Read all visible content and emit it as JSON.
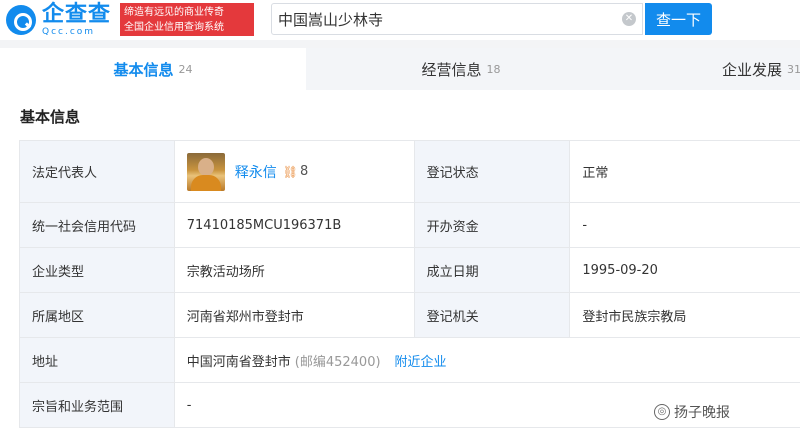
{
  "header": {
    "logo_name": "企查查",
    "logo_domain": "Qcc.com",
    "slogan_line1": "缔造有远见的商业传奇",
    "slogan_line2": "全国企业信用查询系统",
    "search_value": "中国嵩山少林寺",
    "search_button": "查一下"
  },
  "tabs": [
    {
      "label": "基本信息",
      "count": "24"
    },
    {
      "label": "经营信息",
      "count": "18"
    },
    {
      "label": "企业发展",
      "count": "31"
    }
  ],
  "section_title": "基本信息",
  "info": {
    "legal_rep_label": "法定代表人",
    "legal_rep_name": "释永信",
    "legal_rep_related": "8",
    "status_label": "登记状态",
    "status_value": "正常",
    "credit_code_label": "统一社会信用代码",
    "credit_code_value": "71410185MCU196371B",
    "capital_label": "开办资金",
    "capital_value": "-",
    "type_label": "企业类型",
    "type_value": "宗教活动场所",
    "established_label": "成立日期",
    "established_value": "1995-09-20",
    "region_label": "所属地区",
    "region_value": "河南省郑州市登封市",
    "authority_label": "登记机关",
    "authority_value": "登封市民族宗教局",
    "address_label": "地址",
    "address_value": "中国河南省登封市",
    "address_postcode": "(邮编452400)",
    "nearby_link": "附近企业",
    "scope_label": "宗旨和业务范围",
    "scope_value": "-"
  },
  "watermark": "扬子晚报",
  "colors": {
    "accent": "#128bed",
    "label_bg": "#f2f5fa"
  }
}
